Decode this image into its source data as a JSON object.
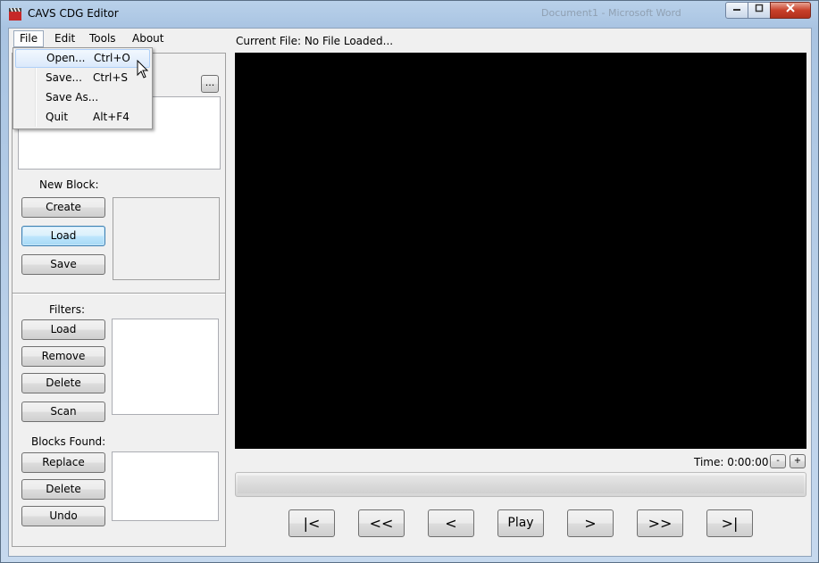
{
  "window": {
    "title": "CAVS CDG Editor",
    "background_title": "Document1 - Microsoft Word"
  },
  "menubar": {
    "items": [
      {
        "label": "File"
      },
      {
        "label": "Edit"
      },
      {
        "label": "Tools"
      },
      {
        "label": "About"
      }
    ]
  },
  "file_menu": {
    "items": [
      {
        "label": "Open...",
        "shortcut": "Ctrl+O"
      },
      {
        "label": "Save...",
        "shortcut": "Ctrl+S"
      },
      {
        "label": "Save As...",
        "shortcut": ""
      },
      {
        "label": "Quit",
        "shortcut": "Alt+F4"
      }
    ]
  },
  "left_panel": {
    "browse_label": "...",
    "new_block": {
      "heading": "New Block:",
      "create": "Create",
      "load": "Load",
      "save": "Save"
    },
    "filters": {
      "heading": "Filters:",
      "load": "Load",
      "remove": "Remove",
      "delete": "Delete",
      "scan": "Scan"
    },
    "blocks_found": {
      "heading": "Blocks Found:",
      "replace": "Replace",
      "delete": "Delete",
      "undo": "Undo"
    }
  },
  "player": {
    "current_file": "Current File: No File Loaded...",
    "time": "Time: 0:00:00",
    "zoom_out": "-",
    "zoom_in": "+",
    "nav": {
      "first": "|<",
      "rewind": "<<",
      "prev": "<",
      "play": "Play",
      "next": ">",
      "forward": ">>",
      "last": ">|"
    }
  },
  "colors": {
    "video_bg": "#000000",
    "window_frame": "#b9d1ea",
    "close_button": "#c8402a",
    "menu_highlight": "#dbe9fb"
  }
}
